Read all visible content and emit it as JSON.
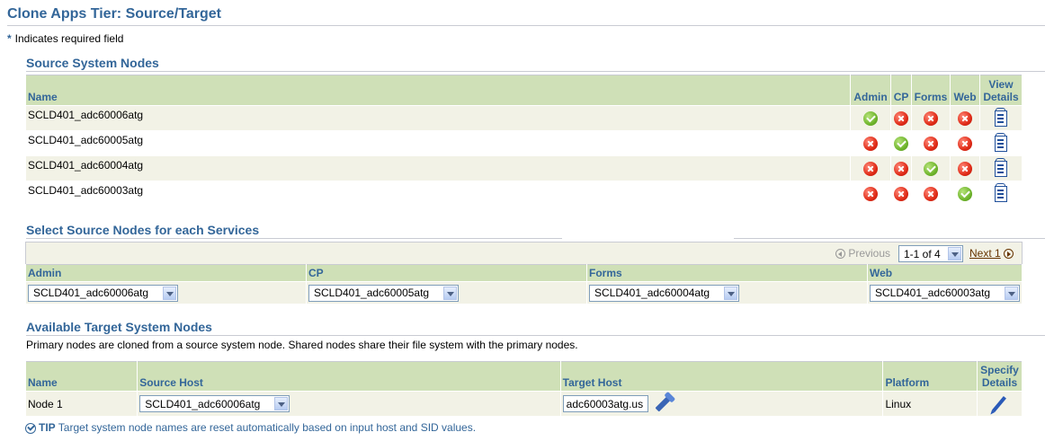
{
  "page": {
    "title": "Clone Apps Tier: Source/Target",
    "required_note": "Indicates required field",
    "required_marker": "*"
  },
  "source_nodes": {
    "header": "Source System Nodes",
    "columns": {
      "name": "Name",
      "admin": "Admin",
      "cp": "CP",
      "forms": "Forms",
      "web": "Web",
      "view_details_1": "View",
      "view_details_2": "Details"
    },
    "rows": [
      {
        "name": "SCLD401_adc60006atg",
        "admin": "ok",
        "cp": "no",
        "forms": "no",
        "web": "no"
      },
      {
        "name": "SCLD401_adc60005atg",
        "admin": "no",
        "cp": "ok",
        "forms": "no",
        "web": "no"
      },
      {
        "name": "SCLD401_adc60004atg",
        "admin": "no",
        "cp": "no",
        "forms": "ok",
        "web": "no"
      },
      {
        "name": "SCLD401_adc60003atg",
        "admin": "no",
        "cp": "no",
        "forms": "no",
        "web": "ok"
      }
    ]
  },
  "select_services": {
    "header": "Select Source Nodes for each Services",
    "nav": {
      "previous": "Previous",
      "range": "1-1 of 4",
      "next": "Next 1"
    },
    "columns": {
      "admin": "Admin",
      "cp": "CP",
      "forms": "Forms",
      "web": "Web"
    },
    "values": {
      "admin": "SCLD401_adc60006atg",
      "cp": "SCLD401_adc60005atg",
      "forms": "SCLD401_adc60004atg",
      "web": "SCLD401_adc60003atg"
    }
  },
  "targets": {
    "header": "Available Target System Nodes",
    "description": "Primary nodes are cloned from a source system node. Shared nodes share their file system with the primary nodes.",
    "columns": {
      "name": "Name",
      "source_host": "Source Host",
      "target_host": "Target Host",
      "platform": "Platform",
      "specify_1": "Specify",
      "specify_2": "Details"
    },
    "row": {
      "name": "Node 1",
      "source_host": "SCLD401_adc60006atg",
      "target_host": "adc60003atg.us",
      "platform": "Linux"
    }
  },
  "tip": {
    "label": "TIP",
    "text": "Target system node names are reset automatically based on input host and SID values."
  },
  "colors": {
    "accent": "#336699",
    "header_bg": "#cfe0b7",
    "band_bg": "#f2f2e6",
    "ok": "#6fb52c",
    "no": "#e02b17"
  }
}
